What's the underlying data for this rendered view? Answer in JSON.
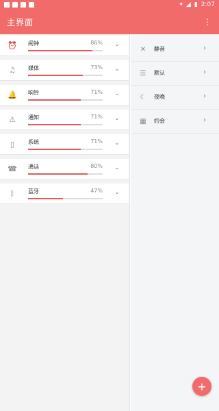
{
  "status_bar": {
    "time": "2:07",
    "left_icons": [
      "square-icon",
      "square-icon",
      "square-icon",
      "square-icon"
    ],
    "right_icons": [
      "wifi-icon",
      "signal-icon",
      "battery-icon"
    ]
  },
  "app_bar": {
    "title": "主界面",
    "menu_icon": "more-vert-icon",
    "menu_glyph": "⋮",
    "color": "#f26b6b"
  },
  "volume_items": [
    {
      "label": "闹钟",
      "percent_text": "86%",
      "value": 0.86,
      "icon": "alarm-icon",
      "glyph": "⏰"
    },
    {
      "label": "媒体",
      "percent_text": "73%",
      "value": 0.73,
      "icon": "music-note-icon",
      "glyph": "♫"
    },
    {
      "label": "响铃",
      "percent_text": "71%",
      "value": 0.71,
      "icon": "bell-icon",
      "glyph": "🔔"
    },
    {
      "label": "通知",
      "percent_text": "71%",
      "value": 0.71,
      "icon": "warning-icon",
      "glyph": "⚠"
    },
    {
      "label": "系统",
      "percent_text": "71%",
      "value": 0.71,
      "icon": "phone-device-icon",
      "glyph": "▯"
    },
    {
      "label": "通话",
      "percent_text": "80%",
      "value": 0.8,
      "icon": "phone-call-icon",
      "glyph": "☎"
    },
    {
      "label": "蓝牙",
      "percent_text": "47%",
      "value": 0.47,
      "icon": "bluetooth-icon",
      "glyph": "ᛒ"
    }
  ],
  "mode_items": [
    {
      "label": "静音",
      "icon": "mute-icon",
      "glyph": "✕"
    },
    {
      "label": "默认",
      "icon": "tune-icon",
      "glyph": "☰"
    },
    {
      "label": "夜晚",
      "icon": "moon-icon",
      "glyph": "☾"
    },
    {
      "label": "约会",
      "icon": "calendar-icon",
      "glyph": "▦"
    }
  ],
  "fab": {
    "label": "+",
    "icon": "add-icon"
  },
  "chevron_glyphs": {
    "down": "⌄",
    "right": "›"
  },
  "colors": {
    "accent": "#f26b6b",
    "bar_fill": "#e05a5a",
    "bar_track": "#dcdcdc"
  }
}
